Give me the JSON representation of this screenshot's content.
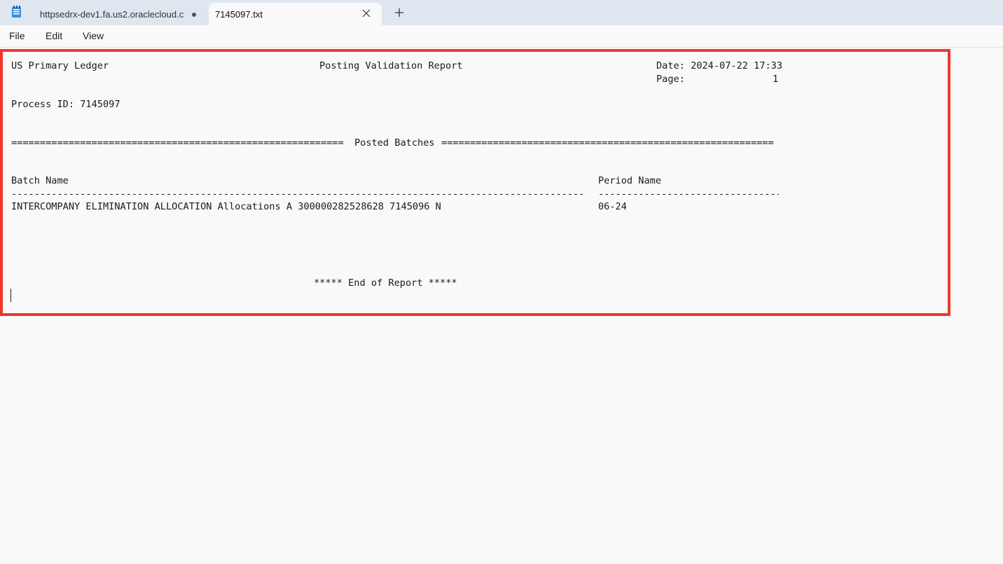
{
  "tabs": [
    {
      "title": "httpsedrx-dev1.fa.us2.oraclecloud.c",
      "unsaved": true
    },
    {
      "title": "7145097.txt",
      "active": true
    }
  ],
  "menu": {
    "file": "File",
    "edit": "Edit",
    "view": "View"
  },
  "report": {
    "ledger": "US Primary Ledger",
    "title": "Posting Validation Report",
    "date_line": "Date: 2024-07-22 17:33",
    "page_label": "Page:",
    "page_number": "1",
    "process_line": "Process ID: 7145097",
    "section_left_rule": "==========================================================",
    "section_title": "Posted Batches",
    "section_right_rule": "==========================================================",
    "col_batch_header": "Batch Name",
    "col_period_header": "Period Name",
    "col_batch_rule": "----------------------------------------------------------------------------------------------------",
    "col_period_rule": "--------------------------------",
    "row_batch": "INTERCOMPANY ELIMINATION ALLOCATION Allocations A 300000282528628 7145096 N",
    "row_period": "06-24",
    "footer": "***** End of Report *****"
  },
  "colors": {
    "highlight": "#f2362b",
    "tabbar": "#dfe6ef"
  }
}
